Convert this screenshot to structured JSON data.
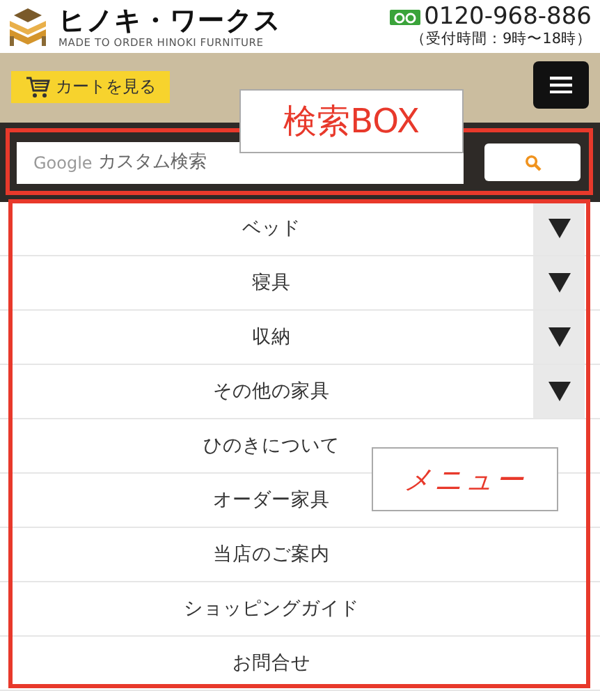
{
  "header": {
    "brand": "ヒノキ・ワークス",
    "tagline": "MADE TO ORDER HINOKI FURNITURE",
    "phone": "0120-968-886",
    "hours": "（受付時間：9時〜18時）"
  },
  "toolbar": {
    "cart_button": "カートを見る"
  },
  "search": {
    "brand": "Google",
    "placeholder": "カスタム検索"
  },
  "menu": [
    {
      "label": "ベッド",
      "expandable": true
    },
    {
      "label": "寝具",
      "expandable": true
    },
    {
      "label": "収納",
      "expandable": true
    },
    {
      "label": "その他の家具",
      "expandable": true
    },
    {
      "label": "ひのきについて",
      "expandable": false
    },
    {
      "label": "オーダー家具",
      "expandable": false
    },
    {
      "label": "当店のご案内",
      "expandable": false
    },
    {
      "label": "ショッピングガイド",
      "expandable": false
    },
    {
      "label": "お問合せ",
      "expandable": false
    }
  ],
  "annotations": [
    {
      "text": "検索BOX"
    },
    {
      "text": "メニュー"
    }
  ]
}
